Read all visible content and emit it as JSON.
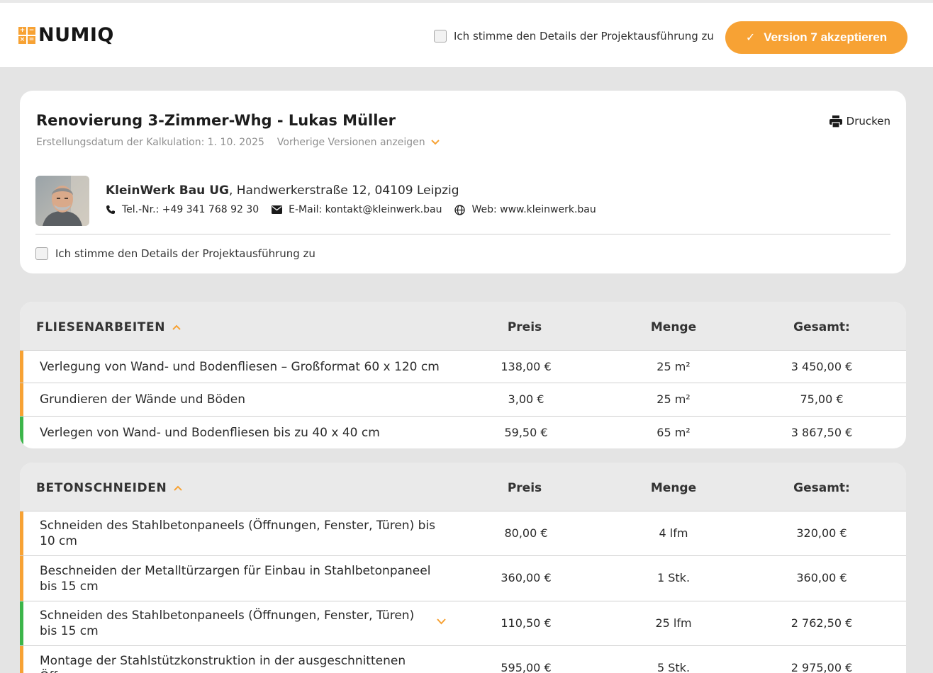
{
  "header": {
    "logo_text": "NUMIQ",
    "logo_symbols": [
      "+",
      "−",
      "×",
      "="
    ],
    "consent_label": "Ich stimme den Details der Projektausführung zu",
    "accept_label": "Version 7 akzeptieren",
    "accent_color": "#f7a234"
  },
  "project": {
    "title": "Renovierung 3-Zimmer-Whg - Lukas Müller",
    "print_label": "Drucken",
    "created_label": "Erstellungsdatum der Kalkulation: 1. 10. 2025",
    "versions_label": "Vorherige Versionen anzeigen",
    "company_name": "KleinWerk Bau UG",
    "company_address": ", Handwerkerstraße 12, 04109 Leipzig",
    "phone": "Tel.-Nr.: +49 341 768 92 30",
    "email": "E-Mail: kontakt@kleinwerk.bau",
    "web": "Web: www.kleinwerk.bau",
    "consent_label": "Ich stimme den Details der Projektausführung zu"
  },
  "columns": {
    "price": "Preis",
    "qty": "Menge",
    "total": "Gesamt:"
  },
  "sections": [
    {
      "title": "FLIESENARBEITEN",
      "rows": [
        {
          "desc": "Verlegung von Wand- und Bodenfliesen – Großformat 60 x 120 cm",
          "price": "138,00 €",
          "qty": "25 m²",
          "total": "3 450,00 €",
          "status_color": "#f7a234"
        },
        {
          "desc": "Grundieren der Wände und Böden",
          "price": "3,00 €",
          "qty": "25 m²",
          "total": "75,00 €",
          "status_color": "#f7a234"
        },
        {
          "desc": "Verlegen von Wand- und Bodenfliesen bis zu 40 x 40 cm",
          "price": "59,50 €",
          "qty": "65 m²",
          "total": "3 867,50 €",
          "status_color": "#3cb54a"
        }
      ]
    },
    {
      "title": "BETONSCHNEIDEN",
      "rows": [
        {
          "desc": "Schneiden des Stahlbetonpaneels (Öffnungen, Fenster, Türen) bis 10 cm",
          "price": "80,00 €",
          "qty": "4 lfm",
          "total": "320,00 €",
          "status_color": "#f7a234"
        },
        {
          "desc": "Beschneiden der Metalltürzargen für Einbau in Stahlbetonpaneel bis 15 cm",
          "price": "360,00 €",
          "qty": "1 Stk.",
          "total": "360,00 €",
          "status_color": "#f7a234"
        },
        {
          "desc": "Schneiden des Stahlbetonpaneels (Öffnungen, Fenster, Türen) bis 15 cm",
          "price": "110,50 €",
          "qty": "25 lfm",
          "total": "2 762,50 €",
          "status_color": "#3cb54a",
          "expandable": true
        },
        {
          "desc": "Montage der Stahlstützkonstruktion in der ausgeschnittenen Öffnung",
          "price": "595,00 €",
          "qty": "5 Stk.",
          "total": "2 975,00 €",
          "status_color": "#f7a234"
        }
      ]
    }
  ]
}
